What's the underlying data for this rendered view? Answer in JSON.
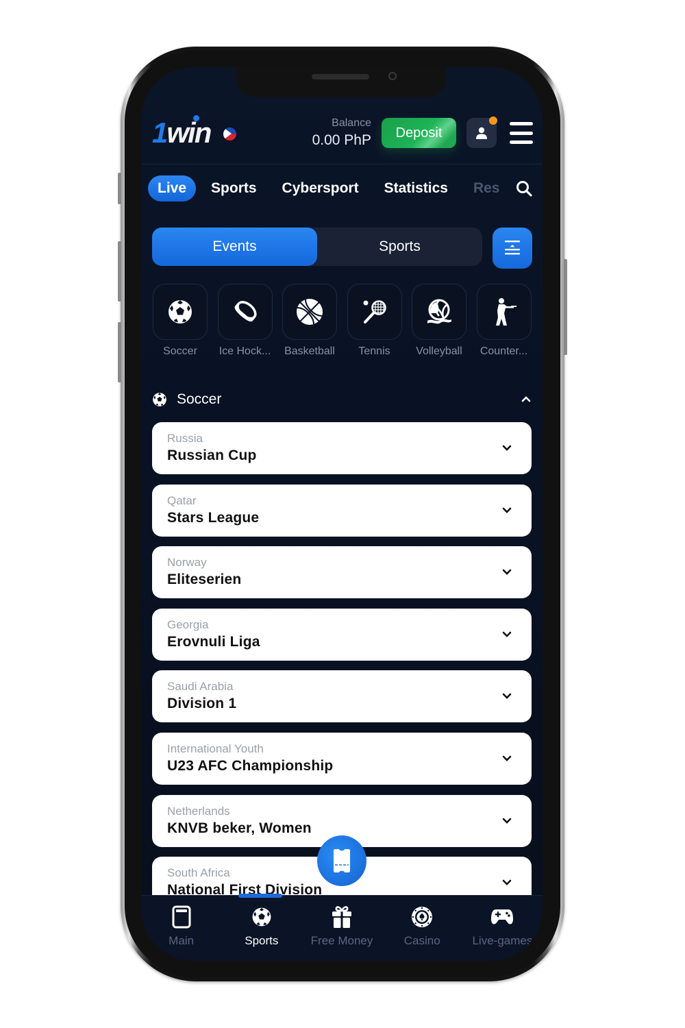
{
  "app": {
    "brand": "1win",
    "brand_one": "1",
    "brand_rest": "win",
    "region_flag": "philippines-flag",
    "accent_color": "#1f7be6",
    "deposit_color": "#1fb357"
  },
  "header": {
    "balance_label": "Balance",
    "balance_value": "0.00 PhP",
    "deposit_label": "Deposit",
    "profile_icon": "user-icon",
    "notification_dot": true,
    "menu_icon": "hamburger-menu-icon"
  },
  "nav": {
    "tabs": [
      {
        "label": "Live",
        "active": true
      },
      {
        "label": "Sports",
        "active": false
      },
      {
        "label": "Cybersport",
        "active": false
      },
      {
        "label": "Statistics",
        "active": false
      },
      {
        "label": "Res",
        "active": false
      }
    ],
    "search_icon": "search-icon"
  },
  "segment": {
    "options": [
      {
        "label": "Events",
        "active": true
      },
      {
        "label": "Sports",
        "active": false
      }
    ],
    "collapse_icon": "collapse-all-icon"
  },
  "categories": [
    {
      "label": "Soccer",
      "icon": "soccer-ball-icon"
    },
    {
      "label": "Ice Hock...",
      "icon": "hockey-puck-icon"
    },
    {
      "label": "Basketball",
      "icon": "basketball-icon"
    },
    {
      "label": "Tennis",
      "icon": "tennis-racket-icon"
    },
    {
      "label": "Volleyball",
      "icon": "volleyball-icon"
    },
    {
      "label": "Counter...",
      "icon": "counter-strike-icon"
    }
  ],
  "section": {
    "title": "Soccer",
    "icon": "soccer-ball-icon",
    "expanded": true
  },
  "leagues": [
    {
      "country": "Russia",
      "name": "Russian Cup"
    },
    {
      "country": "Qatar",
      "name": "Stars League"
    },
    {
      "country": "Norway",
      "name": "Eliteserien"
    },
    {
      "country": "Georgia",
      "name": "Erovnuli Liga"
    },
    {
      "country": "Saudi Arabia",
      "name": "Division 1"
    },
    {
      "country": "International Youth",
      "name": "U23 AFC Championship"
    },
    {
      "country": "Netherlands",
      "name": "KNVB beker, Women"
    },
    {
      "country": "South Africa",
      "name": "National First Division"
    }
  ],
  "fab": {
    "icon": "bet-slip-ticket-icon"
  },
  "bottom_nav": [
    {
      "label": "Main",
      "icon": "main-page-icon",
      "active": false
    },
    {
      "label": "Sports",
      "icon": "soccer-ball-icon",
      "active": true
    },
    {
      "label": "Free Money",
      "icon": "gift-icon",
      "active": false
    },
    {
      "label": "Casino",
      "icon": "casino-chip-icon",
      "active": false
    },
    {
      "label": "Live-games",
      "icon": "gamepad-icon",
      "active": false
    }
  ]
}
